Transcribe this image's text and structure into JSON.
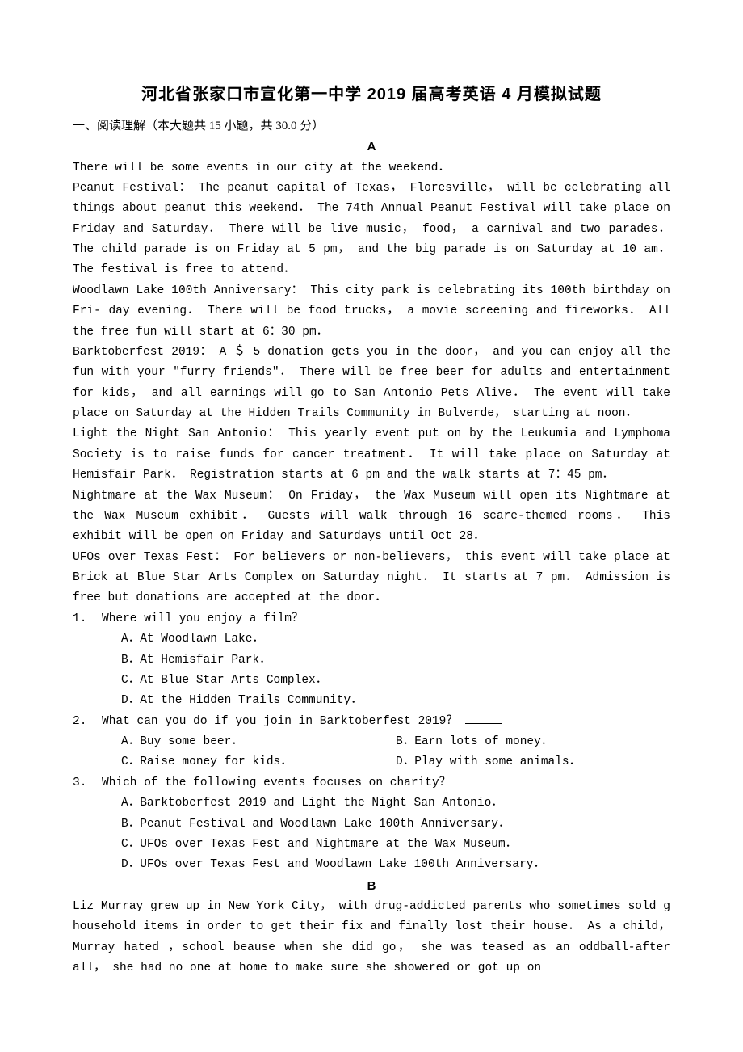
{
  "title": "河北省张家口市宣化第一中学 2019 届高考英语 4 月模拟试题",
  "section_instruction": "一、阅读理解（本大题共 15 小题，共 30.0 分）",
  "passage_a": {
    "label": "A",
    "p1": "There will be some events in our city at the weekend．",
    "p2": "Peanut Festival： The peanut capital of Texas， Floresville， will be celebrating all things about peanut this weekend． The 74th Annual Peanut Festival will take place on Friday and Saturday． There will be live music， food， a carnival and two parades． The child parade is on Friday at 5 pm， and the big parade is on Saturday at 10 am． The festival is free to attend．",
    "p3": "Woodlawn Lake 100th Anniversary： This city park is celebrating its 100th birthday on Fri- day evening． There will be food trucks， a movie screening and fireworks． All the free fun will start at 6：30 pm．",
    "p4": "Barktoberfest 2019： A ＄ 5 donation gets you in the door， and you can enjoy all the fun with your \"furry friends\"． There will be free beer for adults and entertainment for kids， and all earnings will go to San Antonio Pets Alive． The event will take place on Saturday at the Hidden Trails Community in Bulverde， starting at noon．",
    "p5": "Light the Night San Antonio： This yearly event put on by the Leukumia and Lymphoma Society is to raise funds for cancer treatment． It will take place on Saturday at Hemisfair Park． Registration starts at 6 pm and the walk starts at 7：45 pm．",
    "p6": "Nightmare at the Wax Museum： On Friday， the Wax Museum will open its Nightmare at the Wax Museum exhibit． Guests will walk through 16 scare-themed rooms． This exhibit will be open on Friday and Saturdays until Oct 28．",
    "p7": "UFOs over Texas Fest： For believers or non-believers， this event will take place at Brick at Blue Star Arts Complex on Saturday night． It starts at 7 pm． Admission is free but donations are accepted at the door．"
  },
  "questions": [
    {
      "num": "1.",
      "stem": " Where will you enjoy a film？ ",
      "opts": {
        "a": "A．At Woodlawn Lake．",
        "b": "B．At Hemisfair Park．",
        "c": "C．At Blue Star Arts Complex．",
        "d": "D．At the Hidden Trails Community．"
      },
      "layout": "col"
    },
    {
      "num": "2.",
      "stem": " What can you do if you join in Barktoberfest 2019？ ",
      "opts": {
        "a": "A．Buy some beer．",
        "b": "B．Earn lots of money．",
        "c": "C．Raise money for kids．",
        "d": "D．Play with some animals．"
      },
      "layout": "row"
    },
    {
      "num": "3.",
      "stem": " Which of the following events focuses on charity？ ",
      "opts": {
        "a": "A．Barktoberfest 2019 and Light the Night San Antonio．",
        "b": "B．Peanut Festival and Woodlawn Lake 100th Anniversary．",
        "c": "C．UFOs over Texas Fest and Nightmare at the Wax Museum．",
        "d": "D．UFOs over Texas Fest and Woodlawn Lake 100th Anniversary．"
      },
      "layout": "col"
    }
  ],
  "passage_b": {
    "label": "B",
    "p1": "Liz Murray grew up in New York City， with drug-addicted parents who sometimes sold g household items in order to get their fix and finally lost their house． As a child， Murray hated ，school beause when she did go， she was teased as an oddball-after all， she had no one at home to make sure she showered or got up on"
  }
}
